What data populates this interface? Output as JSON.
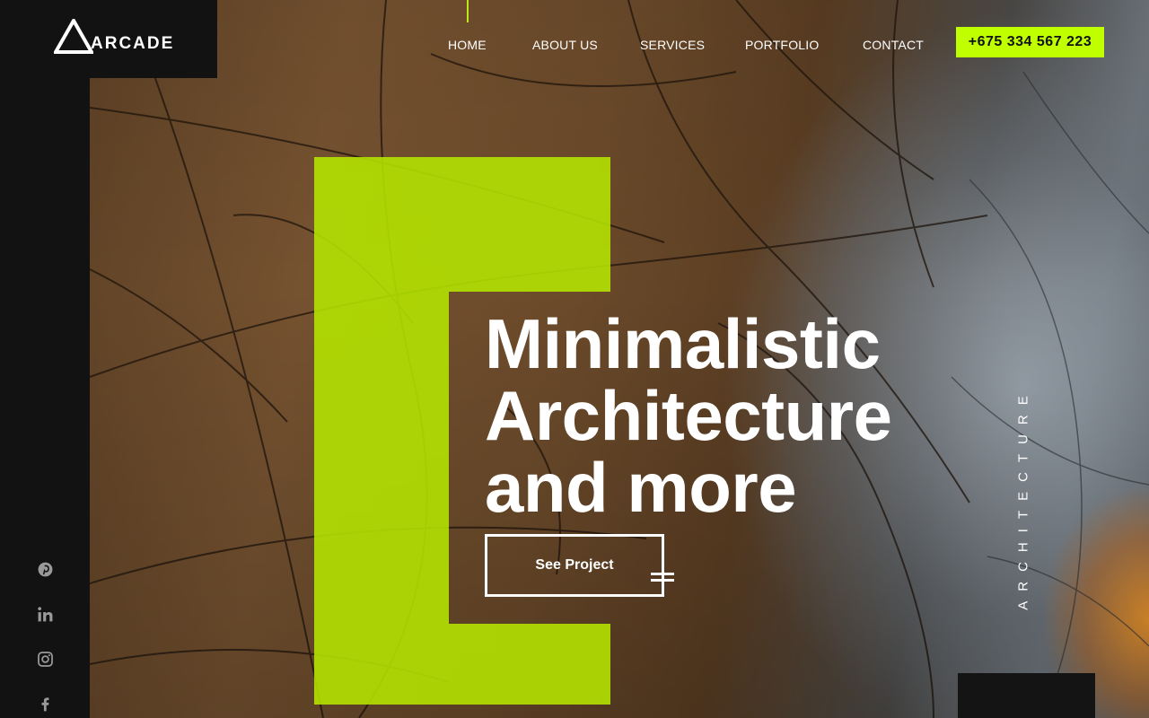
{
  "brand": {
    "name": "ARCADE",
    "accent_color": "#bfff00",
    "dark_color": "#121212"
  },
  "nav": {
    "items": [
      {
        "label": "HOME",
        "active": true
      },
      {
        "label": "ABOUT US"
      },
      {
        "label": "SERVICES"
      },
      {
        "label": "PORTFOLIO"
      },
      {
        "label": "CONTACT"
      }
    ],
    "phone": "+675 334 567 223"
  },
  "hero": {
    "headline": [
      "Minimalistic",
      "Architecture",
      "and more"
    ],
    "cta_label": "See Project",
    "vertical_word": "ARCHITECTURE"
  },
  "social": [
    {
      "icon": "pinterest-icon"
    },
    {
      "icon": "linkedin-icon"
    },
    {
      "icon": "instagram-icon"
    },
    {
      "icon": "facebook-icon"
    }
  ]
}
